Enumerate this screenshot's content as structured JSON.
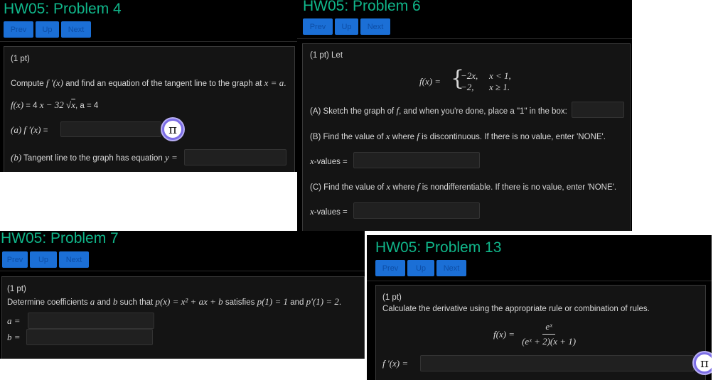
{
  "nav": {
    "prev": "Prev",
    "up": "Up",
    "next": "Next"
  },
  "colors": {
    "title": "#10b68a",
    "button": "#1b6fd6",
    "panel": "#000000",
    "answer_box": "#202020"
  },
  "icons": [
    "pi-icon"
  ],
  "p4": {
    "title": "HW05: Problem 4",
    "points": "(1 pt)",
    "prompt_a": "Compute",
    "prompt_b": "f ′(x)",
    "prompt_c": "and find an equation of the tangent line to the graph at",
    "prompt_d": "x = a",
    "prompt_e": ".",
    "func_a": "f(x)",
    "func_b": "= 4",
    "func_c": "x − 32 √",
    "func_d": "x",
    "func_e": ", a = 4",
    "part_a_label": "(a)",
    "part_a_expr": "f ′(x)",
    "part_a_eq": "=",
    "part_b_label": "(b)",
    "part_b_text": "Tangent line to the graph has equation",
    "part_b_y": "y =",
    "pi": "π"
  },
  "p6": {
    "title": "HW05: Problem 6",
    "points": "(1 pt) Let",
    "fx": "f(x) =",
    "case1_val": "−2x,",
    "case1_cond": "x < 1,",
    "case2_val": "−2,",
    "case2_cond": "x ≥ 1.",
    "brace": "{",
    "part_a_text1": "(A) Sketch the graph of",
    "part_a_f": "f",
    "part_a_text2": ", and when you're done, place a \"1\" in the box:",
    "part_b_text1": "(B) Find the value of",
    "part_b_x": "x",
    "part_b_text2": "where",
    "part_b_f": "f",
    "part_b_text3": "is discontinuous. If there is no value, enter 'NONE'.",
    "xvalues_x": "x",
    "xvalues_label": "-values =",
    "part_c_text1": "(C) Find the value of",
    "part_c_x": "x",
    "part_c_text2": "where",
    "part_c_f": "f",
    "part_c_text3": "is nondifferentiable. If there is no value, enter 'NONE'."
  },
  "p7": {
    "title": "HW05: Problem 7",
    "points": "(1 pt)",
    "prompt1": "Determine coefficients",
    "a": "a",
    "and": "and",
    "b": "b",
    "prompt2": "such that",
    "poly": "p(x) = x² + ax + b",
    "prompt3": "satisfies",
    "cond1": "p(1) = 1",
    "and2": "and",
    "cond2": "p′(1) = 2",
    "period": ".",
    "a_label": "a =",
    "b_label": "b ="
  },
  "p13": {
    "title": "HW05: Problem 13",
    "points": "(1 pt)",
    "prompt": "Calculate the derivative using the appropriate rule or combination of rules.",
    "fx": "f(x) =",
    "num": "eˣ",
    "den": "(eˣ + 2)(x + 1)",
    "fprime": "f ′(x) =",
    "pi": "π"
  }
}
